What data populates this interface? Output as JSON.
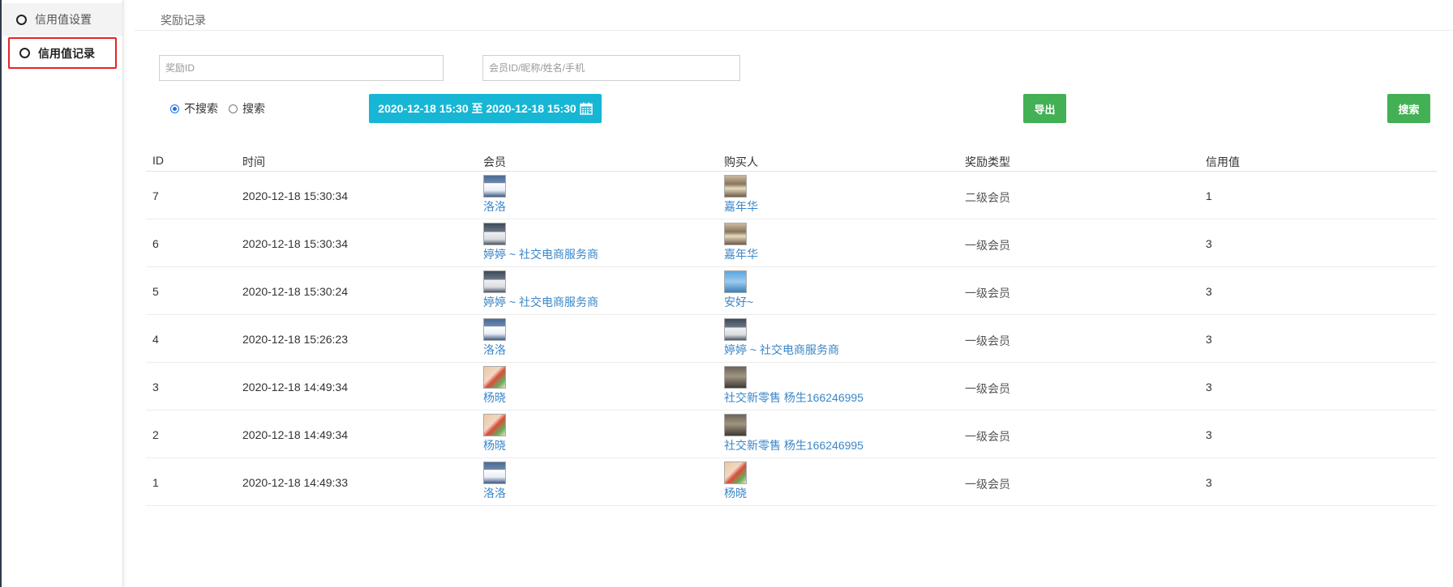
{
  "sidebar": {
    "items": [
      {
        "label": "信用值设置"
      },
      {
        "label": "信用值记录"
      }
    ]
  },
  "page": {
    "title": "奖励记录"
  },
  "filters": {
    "award_id_placeholder": "奖励ID",
    "member_placeholder": "会员ID/昵称/姓名/手机",
    "radio_no_search": "不搜索",
    "radio_search": "搜索",
    "date_range": "2020-12-18 15:30 至 2020-12-18 15:30",
    "export_label": "导出",
    "search_label": "搜索"
  },
  "table": {
    "headers": [
      "ID",
      "时间",
      "会员",
      "购买人",
      "奖励类型",
      "信用值"
    ],
    "rows": [
      {
        "id": "7",
        "time": "2020-12-18 15:30:34",
        "member": "洛洛",
        "buyer": "嘉年华",
        "type": "二级会员",
        "value": "1"
      },
      {
        "id": "6",
        "time": "2020-12-18 15:30:34",
        "member": "婷婷 ~ 社交电商服务商",
        "buyer": "嘉年华",
        "type": "一级会员",
        "value": "3"
      },
      {
        "id": "5",
        "time": "2020-12-18 15:30:24",
        "member": "婷婷 ~ 社交电商服务商",
        "buyer": "安好~",
        "type": "一级会员",
        "value": "3"
      },
      {
        "id": "4",
        "time": "2020-12-18 15:26:23",
        "member": "洛洛",
        "buyer": "婷婷 ~ 社交电商服务商",
        "type": "一级会员",
        "value": "3"
      },
      {
        "id": "3",
        "time": "2020-12-18 14:49:34",
        "member": "杨晓",
        "buyer": "社交新零售 杨生166246995",
        "type": "一级会员",
        "value": "3"
      },
      {
        "id": "2",
        "time": "2020-12-18 14:49:34",
        "member": "杨晓",
        "buyer": "社交新零售 杨生166246995",
        "type": "一级会员",
        "value": "3"
      },
      {
        "id": "1",
        "time": "2020-12-18 14:49:33",
        "member": "洛洛",
        "buyer": "杨晓",
        "type": "一级会员",
        "value": "3"
      }
    ]
  }
}
